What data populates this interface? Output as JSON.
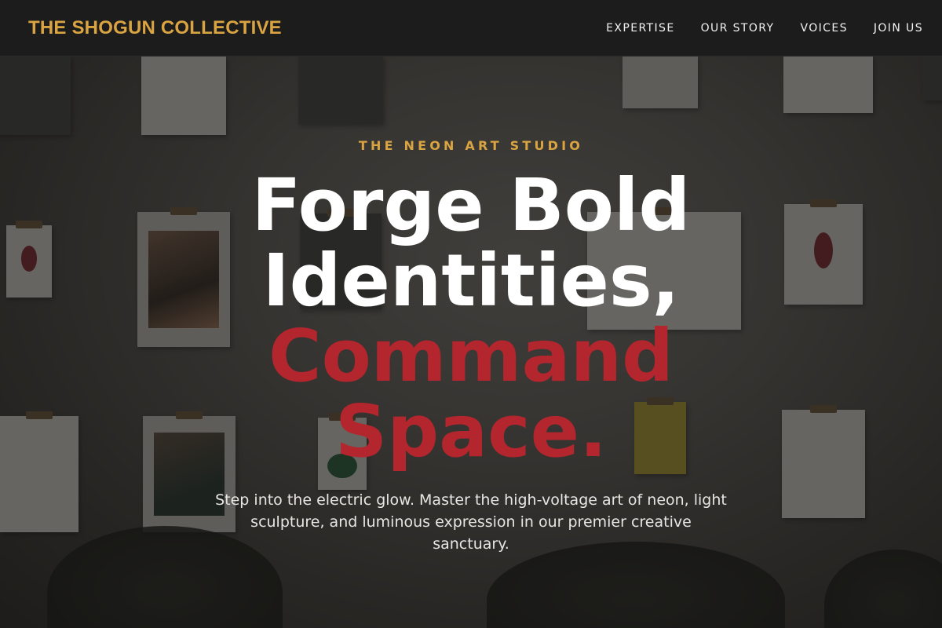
{
  "colors": {
    "accent_gold": "#d9a441",
    "accent_red": "#b3262d",
    "nav_bg": "#1c1c1c",
    "text_white": "#ffffff"
  },
  "nav": {
    "brand": "THE SHOGUN COLLECTIVE",
    "links": [
      "EXPERTISE",
      "OUR STORY",
      "VOICES",
      "JOIN US"
    ]
  },
  "hero": {
    "eyebrow": "THE NEON ART STUDIO",
    "headline": {
      "line1": "Forge Bold",
      "line2": "Identities,",
      "line3": "Command",
      "line4": "Space."
    },
    "subtext": "Step into the electric glow. Master the high-voltage art of neon, light sculpture, and luminous expression in our premier creative sanctuary."
  }
}
